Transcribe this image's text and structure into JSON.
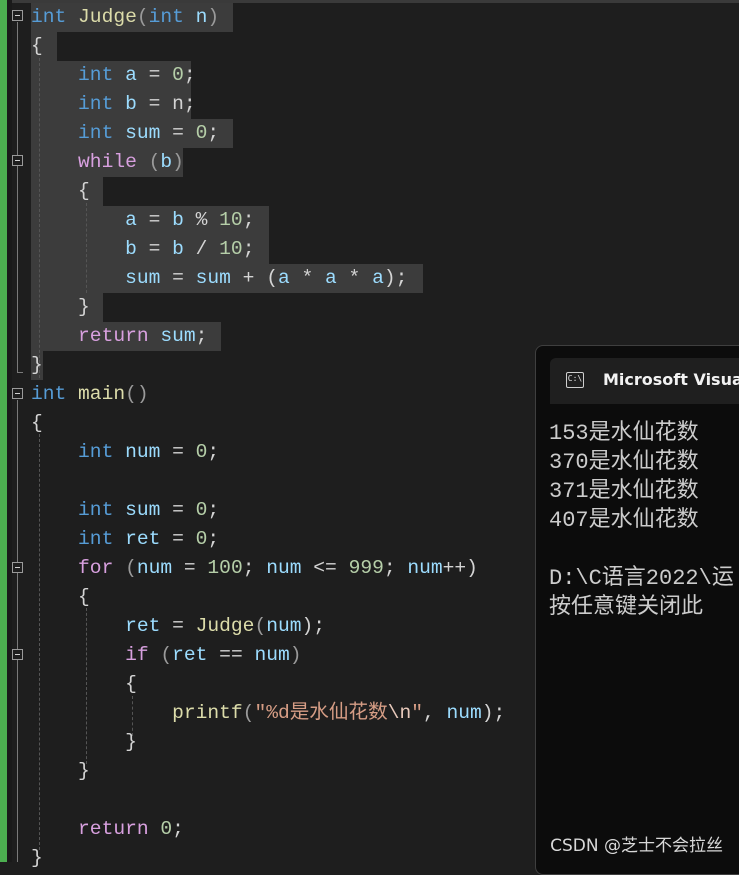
{
  "editor": {
    "lines": [
      [
        "int",
        " ",
        "Judge",
        "(",
        "int",
        " n",
        ")"
      ],
      [
        "{"
      ],
      [
        "    ",
        "int",
        " ",
        "a",
        " = ",
        "0",
        ";"
      ],
      [
        "    ",
        "int",
        " ",
        "b",
        " = ",
        "n",
        ";"
      ],
      [
        "    ",
        "int",
        " ",
        "sum",
        " = ",
        "0",
        ";"
      ],
      [
        "    ",
        "while",
        " (",
        "b",
        ")"
      ],
      [
        "    {"
      ],
      [
        "        ",
        "a",
        " = ",
        "b",
        " % ",
        "10",
        ";"
      ],
      [
        "        ",
        "b",
        " = ",
        "b",
        " / ",
        "10",
        ";"
      ],
      [
        "        ",
        "sum",
        " = ",
        "sum",
        " + (",
        "a",
        " * ",
        "a",
        " * ",
        "a",
        ");"
      ],
      [
        "    }"
      ],
      [
        "    ",
        "return",
        " ",
        "sum",
        ";"
      ],
      [
        "}"
      ],
      [
        "int",
        " ",
        "main",
        "()"
      ],
      [
        "{"
      ],
      [
        "    ",
        "int",
        " ",
        "num",
        " = ",
        "0",
        ";"
      ],
      [
        ""
      ],
      [
        "    ",
        "int",
        " ",
        "sum",
        " = ",
        "0",
        ";"
      ],
      [
        "    ",
        "int",
        " ",
        "ret",
        " = ",
        "0",
        ";"
      ],
      [
        "    ",
        "for",
        " (",
        "num",
        " = ",
        "100",
        "; ",
        "num",
        " <= ",
        "999",
        "; ",
        "num",
        "++)"
      ],
      [
        "    {"
      ],
      [
        "        ",
        "ret",
        " = ",
        "Judge",
        "(",
        "num",
        ");"
      ],
      [
        "        ",
        "if",
        " (",
        "ret",
        " == ",
        "num",
        ")"
      ],
      [
        "        {"
      ],
      [
        "            ",
        "printf",
        "(",
        "\"%d是水仙花数",
        "\\n",
        "\"",
        ", ",
        "num",
        ");"
      ],
      [
        "        }"
      ],
      [
        "    }"
      ],
      [
        ""
      ],
      [
        "    ",
        "return",
        " ",
        "0",
        ";"
      ],
      [
        "}"
      ]
    ]
  },
  "console": {
    "title": "Microsoft Visual",
    "icon": "console-app-icon",
    "icon_text": "C:\\",
    "output": [
      "153是水仙花数",
      "370是水仙花数",
      "371是水仙花数",
      "407是水仙花数",
      "",
      "D:\\C语言2022\\运",
      "按任意键关闭此"
    ]
  },
  "watermark": "CSDN @芝士不会拉丝",
  "colors": {
    "background": "#1e1e1e",
    "keyword": "#569cd6",
    "control": "#d8a0df",
    "function": "#dcdcaa",
    "variable": "#9cdcfe",
    "number": "#b5cea8",
    "string": "#d69d85",
    "gutter": "#4caf50"
  }
}
